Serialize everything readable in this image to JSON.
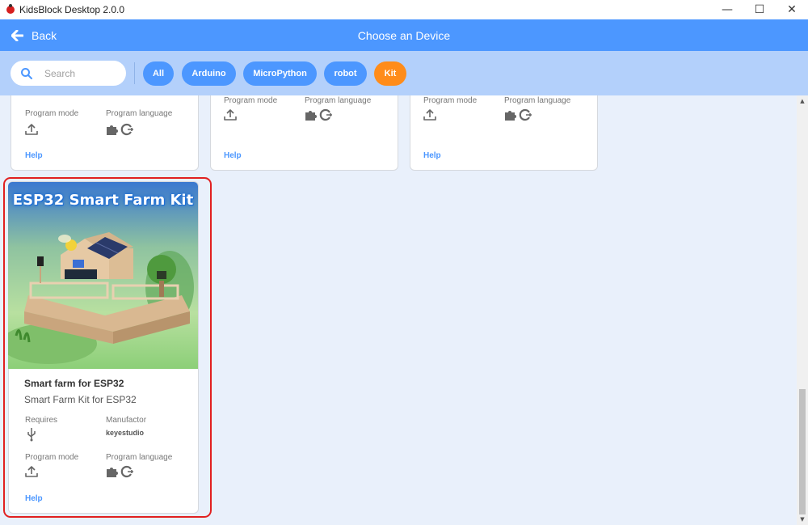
{
  "window": {
    "title": "KidsBlock Desktop 2.0.0",
    "minimize_glyph": "—",
    "maximize_glyph": "☐",
    "close_glyph": "✕"
  },
  "header": {
    "back_label": "Back",
    "title": "Choose an Device"
  },
  "search": {
    "placeholder": "Search"
  },
  "filters": [
    {
      "label": "All",
      "color": "#4c97ff"
    },
    {
      "label": "Arduino",
      "color": "#4c97ff"
    },
    {
      "label": "MicroPython",
      "color": "#4c97ff"
    },
    {
      "label": "robot",
      "color": "#4c97ff"
    },
    {
      "label": "Kit",
      "color": "#ff8c1a",
      "selected": true
    }
  ],
  "top_cards": [
    {
      "program_mode_label": "Program mode",
      "program_language_label": "Program language",
      "help_label": "Help"
    },
    {
      "program_mode_label": "Program mode",
      "program_language_label": "Program language",
      "help_label": "Help"
    },
    {
      "program_mode_label": "Program mode",
      "program_language_label": "Program language",
      "help_label": "Help"
    }
  ],
  "featured_card": {
    "image_caption": "ESP32 Smart Farm Kit",
    "name": "Smart farm for ESP32",
    "description": "Smart Farm Kit for ESP32",
    "requires_label": "Requires",
    "manufactor_label": "Manufactor",
    "manufactor_value": "keyestudio",
    "program_mode_label": "Program mode",
    "program_language_label": "Program language",
    "help_label": "Help"
  },
  "icons": {
    "upload": "upload-icon",
    "puzzle": "puzzle-icon",
    "code": "code-language-icon",
    "usb": "usb-icon",
    "search": "search-icon",
    "back": "arrow-left-icon"
  },
  "colors": {
    "header": "#4c97ff",
    "filter_bar": "#b3d0fb",
    "selected_filter": "#ff8c1a",
    "highlight_border": "#e12020",
    "help_link": "#4c97ff"
  }
}
